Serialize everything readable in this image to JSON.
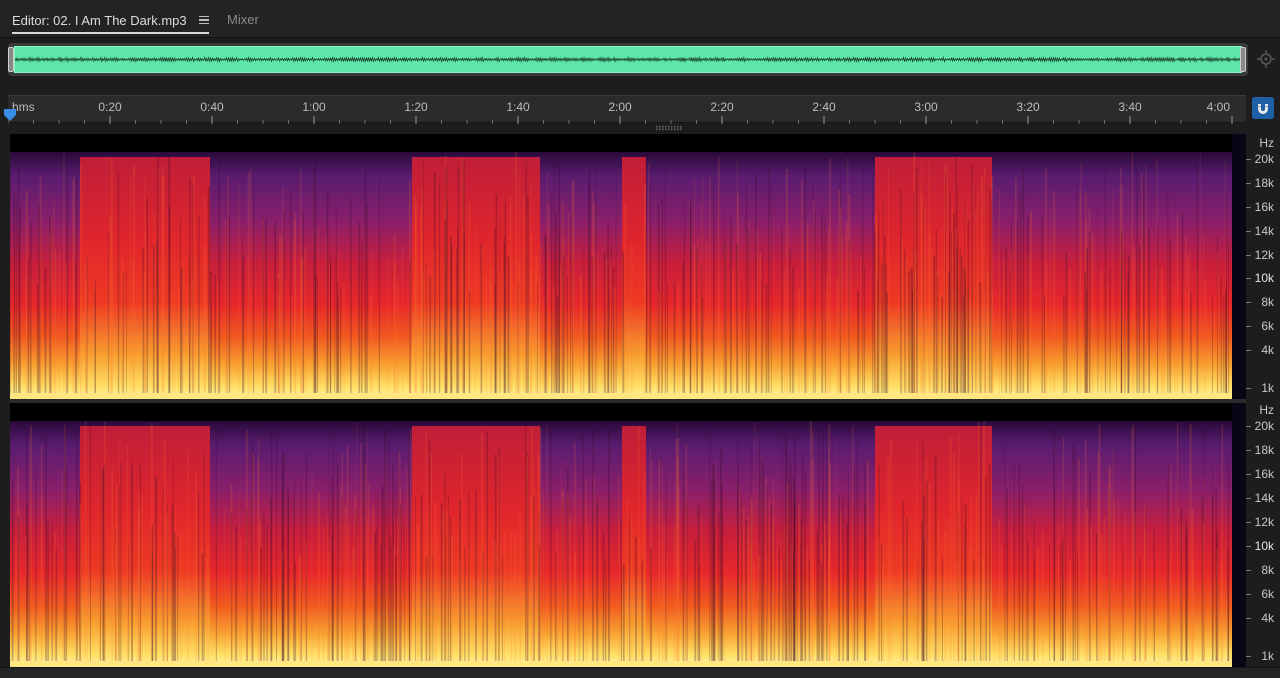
{
  "tabs": {
    "editor_label": "Editor: 02. I Am The Dark.mp3",
    "mixer_label": "Mixer"
  },
  "ruler": {
    "unit_label": "hms",
    "ticks": [
      "0:20",
      "0:40",
      "1:00",
      "1:20",
      "1:40",
      "2:00",
      "2:20",
      "2:40",
      "3:00",
      "3:20",
      "3:40",
      "4:00"
    ]
  },
  "freq_axis": {
    "top": {
      "unit": "Hz",
      "labels": [
        "20k",
        "18k",
        "16k",
        "14k",
        "12k",
        "10k",
        "8k",
        "6k",
        "4k",
        "1k"
      ]
    },
    "bottom": {
      "unit": "Hz",
      "labels": [
        "20k",
        "18k",
        "16k",
        "14k",
        "12k",
        "10k",
        "8k",
        "6k",
        "4k",
        "1k"
      ]
    }
  },
  "icons": {
    "tab_menu": "hamburger-icon",
    "zoom_nav": "zoom-navigator-icon",
    "snap": "magnet-icon",
    "playhead": "playhead-marker-icon"
  },
  "colors": {
    "overview_wave_bg": "#5de6a8",
    "accent_blue": "#3a8ee6",
    "spectral_low": "#ffe066",
    "spectral_mid": "#e8252a",
    "spectral_high": "#6a1f7a",
    "spectral_empty": "#000000"
  }
}
